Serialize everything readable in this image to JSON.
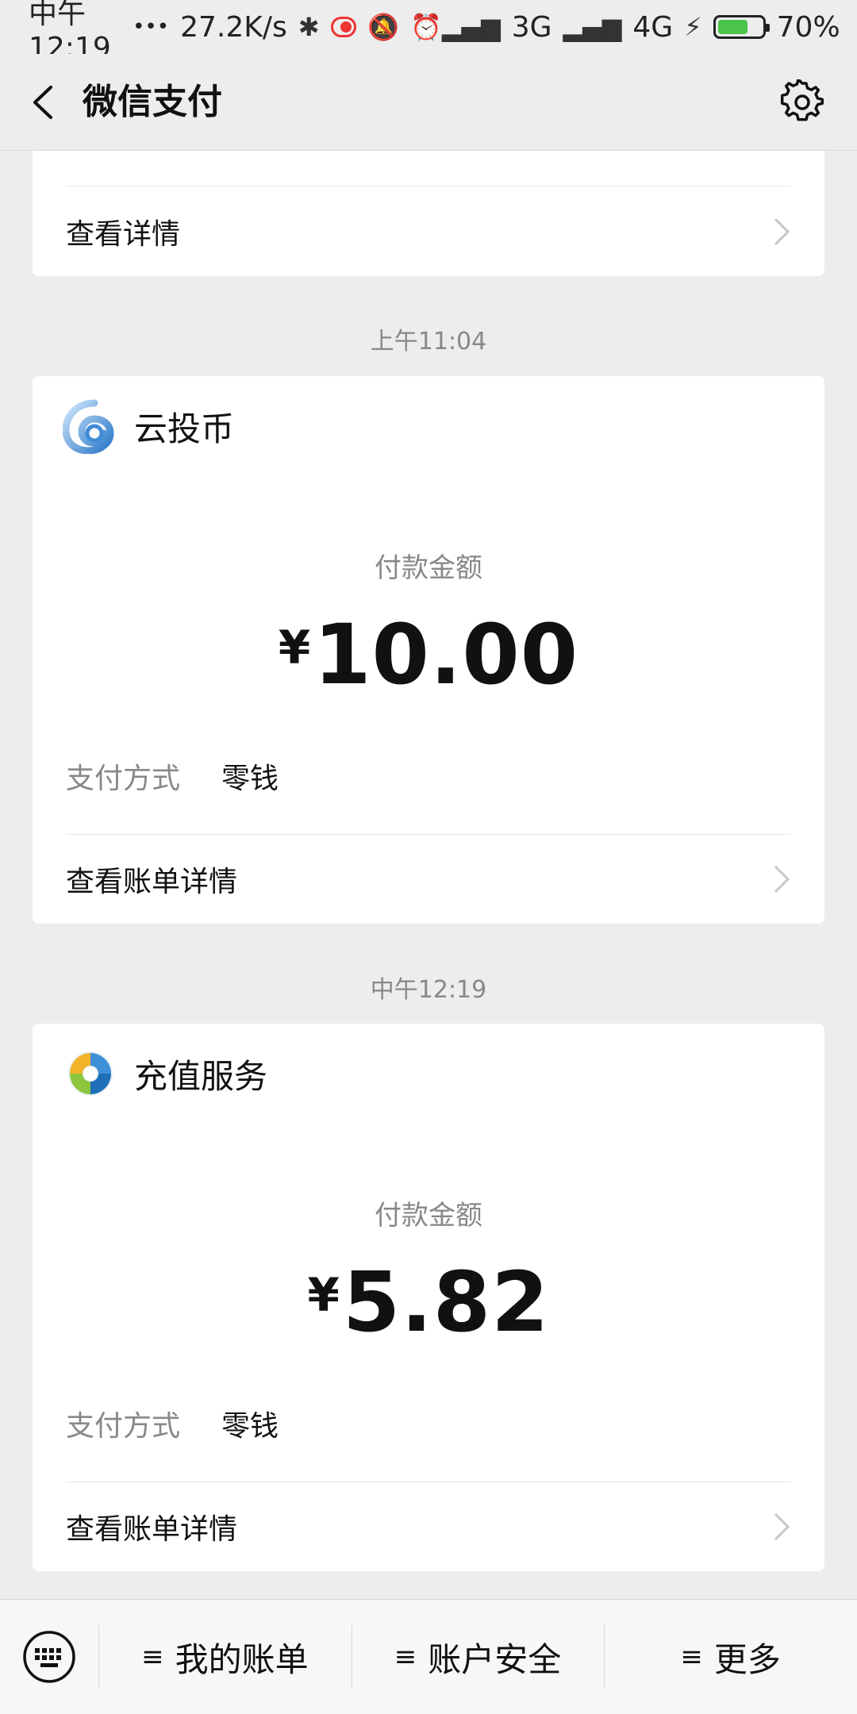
{
  "status": {
    "time": "中午12:19",
    "dots": "•••",
    "speed": "27.2K/s",
    "net1": "3G",
    "net2": "4G",
    "battery_pct_text": "70%",
    "battery_level": 0.7
  },
  "nav": {
    "title": "微信支付"
  },
  "top_card": {
    "link_label": "查看详情"
  },
  "messages": [
    {
      "time": "上午11:04",
      "merchant": "云投币",
      "pay_label": "付款金额",
      "currency": "¥",
      "amount": "10.00",
      "method_key": "支付方式",
      "method_value": "零钱",
      "link_label": "查看账单详情"
    },
    {
      "time": "中午12:19",
      "merchant": "充值服务",
      "pay_label": "付款金额",
      "currency": "¥",
      "amount": "5.82",
      "method_key": "支付方式",
      "method_value": "零钱",
      "link_label": "查看账单详情"
    }
  ],
  "bottom": {
    "menu": [
      "我的账单",
      "账户安全",
      "更多"
    ]
  },
  "colors": {
    "background": "#ededed",
    "card": "#ffffff",
    "muted": "#888888"
  }
}
